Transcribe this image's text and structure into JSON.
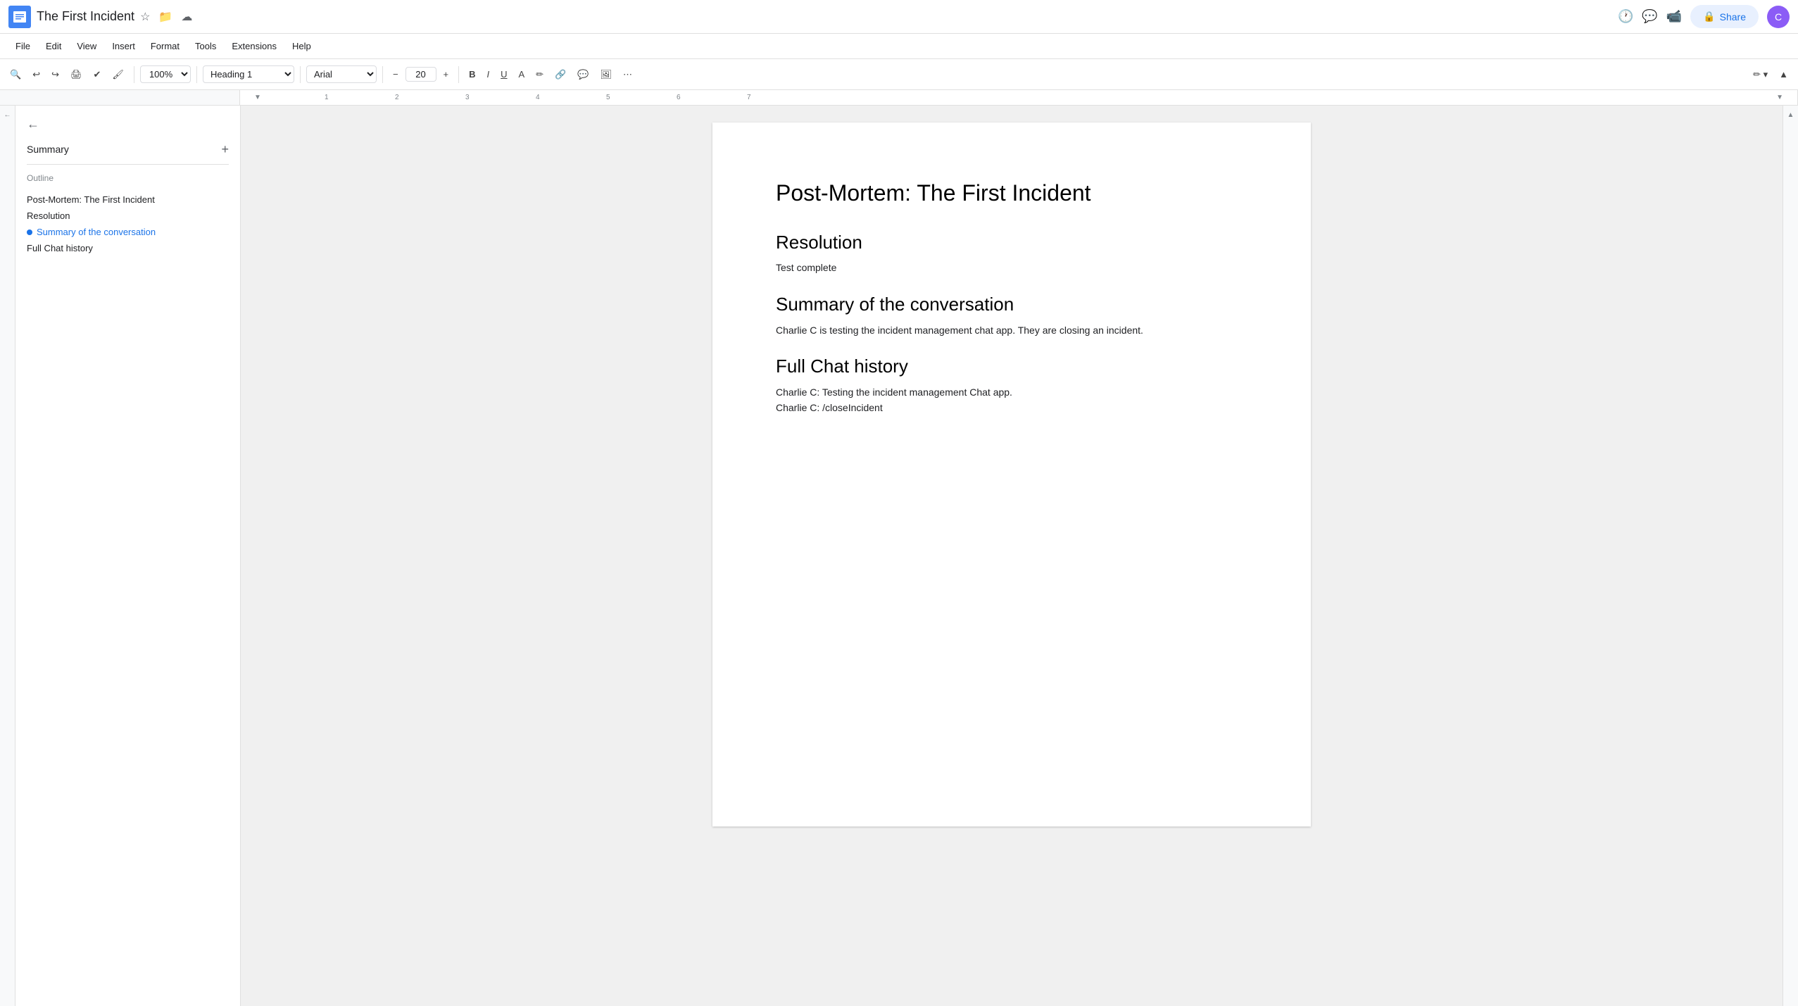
{
  "titleBar": {
    "docTitle": "The First Incident",
    "shareLabel": "Share"
  },
  "menuBar": {
    "items": [
      "File",
      "Edit",
      "View",
      "Insert",
      "Format",
      "Tools",
      "Extensions",
      "Help"
    ]
  },
  "toolbar": {
    "zoom": "100%",
    "style": "Heading 1",
    "font": "Arial",
    "fontSize": "20",
    "boldLabel": "B",
    "italicLabel": "I",
    "underlineLabel": "U"
  },
  "sidebar": {
    "summaryLabel": "Summary",
    "outlineLabel": "Outline",
    "outlineItems": [
      {
        "text": "Post-Mortem: The First Incident",
        "active": false
      },
      {
        "text": "Resolution",
        "active": false
      },
      {
        "text": "Summary of the conversation",
        "active": true
      },
      {
        "text": "Full Chat history",
        "active": false
      }
    ]
  },
  "document": {
    "mainTitle": "Post-Mortem: The First Incident",
    "sections": [
      {
        "heading": "Resolution",
        "body": "Test complete"
      },
      {
        "heading": "Summary of the conversation",
        "body": "Charlie C is testing the incident management chat app. They are closing an incident."
      },
      {
        "heading": "Full Chat history",
        "body": "Charlie C: Testing the incident management Chat app.\nCharlie C: /closeIncident"
      }
    ]
  }
}
